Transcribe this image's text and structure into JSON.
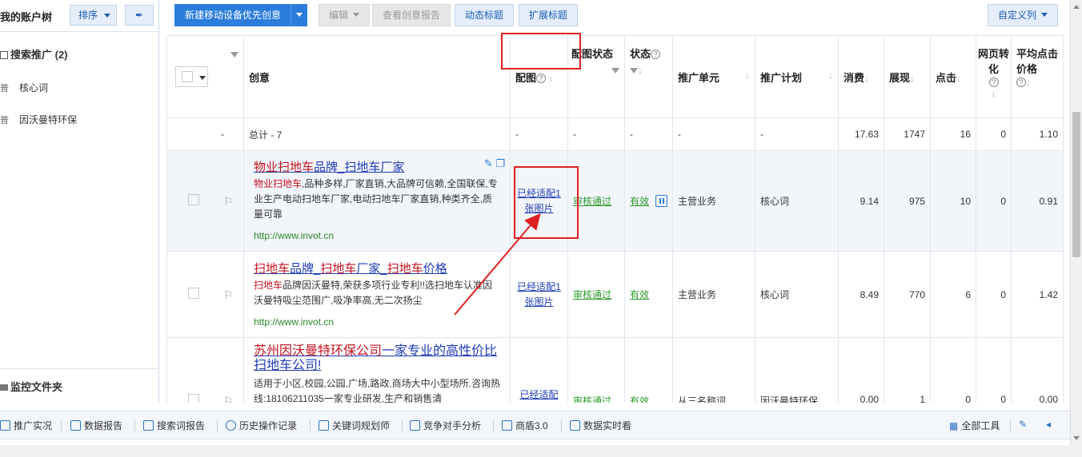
{
  "left": {
    "tree_title": "我的账户树",
    "sort_label": "排序",
    "pin_icon": "pin-icon",
    "search_promo": "搜索推广 (2)",
    "items": [
      {
        "badge": "普",
        "label": "核心词"
      },
      {
        "badge": "普",
        "label": "因沃曼特环保"
      }
    ],
    "monitor": "监控文件夹"
  },
  "toolbar": {
    "new_btn": "新建移动设备优先创意",
    "edit_btn": "编辑",
    "report_btn": "查看创意报告",
    "dynamic_btn": "动态标题",
    "extend_btn": "扩展标题",
    "custom_btn": "自定义列"
  },
  "table": {
    "headers": {
      "creative": "创意",
      "image": "配图",
      "image_status": "配图状态",
      "status": "状态",
      "unit": "推广单元",
      "plan": "推广计划",
      "cost": "消费",
      "impr": "展现",
      "click": "点击",
      "conv": "网页转化",
      "cpc": "平均点击价格"
    },
    "summary": {
      "dash": "-",
      "label": "总计 - 7",
      "cost": "17.63",
      "impr": "1747",
      "click": "16",
      "conv": "0",
      "cpc": "1.10"
    },
    "rows": [
      {
        "title_kw1": "物业扫地车",
        "title_rest1": "品牌_",
        "title_kw2": "扫地车",
        "title_rest2": "厂家",
        "desc_kw": "物业扫地车",
        "desc_rest": ",品种多样,厂家直销,大品牌可信赖,全国联保,专业生产电动扫地车厂家,电动扫地车厂家直销,种类齐全,质量可靠",
        "url": "http://www.invot.cn",
        "image": "已经适配1张图片",
        "image_status": "审核通过",
        "status": "有效",
        "unit": "主营业务",
        "plan": "核心词",
        "cost": "9.14",
        "impr": "975",
        "click": "10",
        "conv": "0",
        "cpc": "0.91"
      },
      {
        "title_kw1": "扫地车",
        "title_rest1": "品牌_",
        "title_kw2": "扫地车",
        "title_rest2": "厂家_",
        "title_kw3": "扫地车",
        "title_rest3": "价格",
        "desc_kw": "扫地车",
        "desc_rest": "品牌因沃曼特,荣获多项行业专利!!选扫地车认准因沃曼特吸尘范围广,吸净率高,无二次扬尘",
        "url": "http://www.invot.cn",
        "image": "已经适配1张图片",
        "image_status": "审核通过",
        "status": "有效",
        "unit": "主营业务",
        "plan": "核心词",
        "cost": "8.49",
        "impr": "770",
        "click": "6",
        "conv": "0",
        "cpc": "1.42"
      },
      {
        "title_kw1": "苏州因沃曼特环保公司",
        "title_rest1": "一家专业的高性价比扫地车公司!",
        "desc_rest": "适用于小区,校园,公园,广场,路政,商场大中小型场所.咨询热线:18106211035一家专业研发,生产和销售清",
        "image": "已经适配",
        "image_status": "审核通过",
        "status": "有效",
        "unit": "从三名称词",
        "plan": "因沃曼特环保",
        "cost": "0.00",
        "impr": "1",
        "click": "0",
        "conv": "0",
        "cpc": "0.00"
      }
    ]
  },
  "bottombar": {
    "items": [
      "推广实况",
      "数据报告",
      "搜索词报告",
      "历史操作记录",
      "关键词规划师",
      "竞争对手分析",
      "商盾3.0",
      "数据实时看"
    ],
    "all_tools": "全部工具"
  },
  "colors": {
    "accent": "#2b7ddb",
    "keyword": "#c1121f",
    "annotation": "#e02020"
  }
}
